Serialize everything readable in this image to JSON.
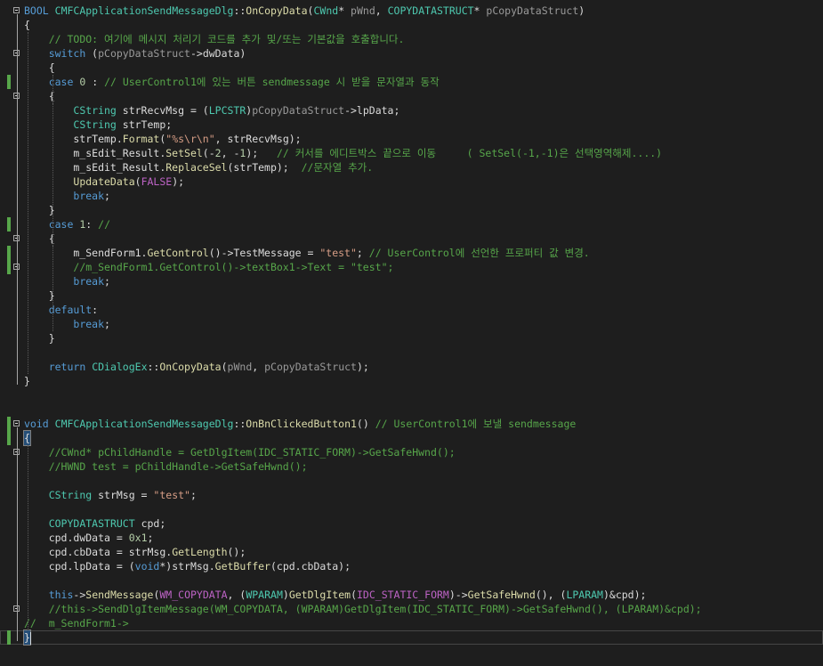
{
  "colors": {
    "text": "#dcdcdc",
    "keyword": "#569cd6",
    "type": "#4ec9b0",
    "function": "#dcdcaa",
    "string": "#d69d85",
    "comment": "#57a64a",
    "macro": "#bd63c5",
    "param": "#9a9a9a",
    "number": "#b5cea8",
    "member": "#dadada",
    "change_marker": "#57a64a"
  },
  "icons": {
    "fold": "collapse-minus-icon",
    "change": "change-marker-icon"
  },
  "editor": {
    "lines": [
      {
        "fold": true,
        "mark": false,
        "tokens": [
          [
            "kw",
            "BOOL"
          ],
          [
            "t",
            " "
          ],
          [
            "ty",
            "CMFCApplicationSendMessageDlg"
          ],
          [
            "t",
            "::"
          ],
          [
            "fn",
            "OnCopyData"
          ],
          [
            "t",
            "("
          ],
          [
            "ty",
            "CWnd"
          ],
          [
            "t",
            "* "
          ],
          [
            "pa",
            "pWnd"
          ],
          [
            "t",
            ", "
          ],
          [
            "ty",
            "COPYDATASTRUCT"
          ],
          [
            "t",
            "* "
          ],
          [
            "pa",
            "pCopyDataStruct"
          ],
          [
            "t",
            ")"
          ]
        ]
      },
      {
        "fold": false,
        "mark": false,
        "tokens": [
          [
            "t",
            "{"
          ]
        ]
      },
      {
        "fold": false,
        "mark": false,
        "tokens": [
          [
            "t",
            "    "
          ],
          [
            "cm",
            "// TODO: 여기에 메시지 처리기 코드를 추가 및/또는 기본값을 호출합니다."
          ]
        ]
      },
      {
        "fold": true,
        "mark": false,
        "tokens": [
          [
            "t",
            "    "
          ],
          [
            "kw",
            "switch"
          ],
          [
            "t",
            " ("
          ],
          [
            "pa",
            "pCopyDataStruct"
          ],
          [
            "t",
            "->"
          ],
          [
            "mb",
            "dwData"
          ],
          [
            "t",
            ")"
          ]
        ]
      },
      {
        "fold": false,
        "mark": false,
        "tokens": [
          [
            "t",
            "    {"
          ]
        ]
      },
      {
        "fold": false,
        "mark": true,
        "tokens": [
          [
            "t",
            "    "
          ],
          [
            "kw",
            "case"
          ],
          [
            "t",
            " "
          ],
          [
            "nm",
            "0"
          ],
          [
            "t",
            " : "
          ],
          [
            "cm",
            "// UserControl1에 있는 버튼 sendmessage 시 받을 문자열과 동작"
          ]
        ]
      },
      {
        "fold": true,
        "mark": false,
        "tokens": [
          [
            "t",
            "    {"
          ]
        ]
      },
      {
        "fold": false,
        "mark": false,
        "tokens": [
          [
            "t",
            "        "
          ],
          [
            "ty",
            "CString"
          ],
          [
            "t",
            " strRecvMsg = ("
          ],
          [
            "ty",
            "LPCSTR"
          ],
          [
            "t",
            ")"
          ],
          [
            "pa",
            "pCopyDataStruct"
          ],
          [
            "t",
            "->"
          ],
          [
            "mb",
            "lpData"
          ],
          [
            "t",
            ";"
          ]
        ]
      },
      {
        "fold": false,
        "mark": false,
        "tokens": [
          [
            "t",
            "        "
          ],
          [
            "ty",
            "CString"
          ],
          [
            "t",
            " strTemp;"
          ]
        ]
      },
      {
        "fold": false,
        "mark": false,
        "tokens": [
          [
            "t",
            "        strTemp."
          ],
          [
            "fn",
            "Format"
          ],
          [
            "t",
            "("
          ],
          [
            "st",
            "\"%s\\r\\n\""
          ],
          [
            "t",
            ", strRecvMsg);"
          ]
        ]
      },
      {
        "fold": false,
        "mark": false,
        "tokens": [
          [
            "t",
            "        m_sEdit_Result."
          ],
          [
            "fn",
            "SetSel"
          ],
          [
            "t",
            "(-"
          ],
          [
            "nm",
            "2"
          ],
          [
            "t",
            ", -"
          ],
          [
            "nm",
            "1"
          ],
          [
            "t",
            ");   "
          ],
          [
            "cm",
            "// 커서를 에디트박스 끝으로 이동     ( SetSel(-1,-1)은 선택영역해제....)"
          ]
        ]
      },
      {
        "fold": false,
        "mark": false,
        "tokens": [
          [
            "t",
            "        m_sEdit_Result."
          ],
          [
            "fn",
            "ReplaceSel"
          ],
          [
            "t",
            "(strTemp);  "
          ],
          [
            "cm",
            "//문자열 추가."
          ]
        ]
      },
      {
        "fold": false,
        "mark": false,
        "tokens": [
          [
            "t",
            "        "
          ],
          [
            "fn",
            "UpdateData"
          ],
          [
            "t",
            "("
          ],
          [
            "mc",
            "FALSE"
          ],
          [
            "t",
            ");"
          ]
        ]
      },
      {
        "fold": false,
        "mark": false,
        "tokens": [
          [
            "t",
            "        "
          ],
          [
            "kw",
            "break"
          ],
          [
            "t",
            ";"
          ]
        ]
      },
      {
        "fold": false,
        "mark": false,
        "tokens": [
          [
            "t",
            "    }"
          ]
        ]
      },
      {
        "fold": false,
        "mark": true,
        "tokens": [
          [
            "t",
            "    "
          ],
          [
            "kw",
            "case"
          ],
          [
            "t",
            " "
          ],
          [
            "nm",
            "1"
          ],
          [
            "t",
            ": "
          ],
          [
            "cm",
            "//"
          ]
        ]
      },
      {
        "fold": true,
        "mark": false,
        "tokens": [
          [
            "t",
            "    {"
          ]
        ]
      },
      {
        "fold": false,
        "mark": true,
        "tokens": [
          [
            "t",
            "        m_SendForm1."
          ],
          [
            "fn",
            "GetControl"
          ],
          [
            "t",
            "()->TestMessage = "
          ],
          [
            "st",
            "\"test\""
          ],
          [
            "t",
            "; "
          ],
          [
            "cm",
            "// UserControl에 선언한 프로퍼티 값 변경."
          ]
        ]
      },
      {
        "fold": true,
        "mark": true,
        "tokens": [
          [
            "t",
            "        "
          ],
          [
            "cm",
            "//m_SendForm1.GetControl()->textBox1->Text = \"test\";"
          ]
        ]
      },
      {
        "fold": false,
        "mark": false,
        "tokens": [
          [
            "t",
            "        "
          ],
          [
            "kw",
            "break"
          ],
          [
            "t",
            ";"
          ]
        ]
      },
      {
        "fold": false,
        "mark": false,
        "tokens": [
          [
            "t",
            "    }"
          ]
        ]
      },
      {
        "fold": false,
        "mark": false,
        "tokens": [
          [
            "t",
            "    "
          ],
          [
            "kw",
            "default"
          ],
          [
            "t",
            ":"
          ]
        ]
      },
      {
        "fold": false,
        "mark": false,
        "tokens": [
          [
            "t",
            "        "
          ],
          [
            "kw",
            "break"
          ],
          [
            "t",
            ";"
          ]
        ]
      },
      {
        "fold": false,
        "mark": false,
        "tokens": [
          [
            "t",
            "    }"
          ]
        ]
      },
      {
        "fold": false,
        "mark": false,
        "tokens": [
          [
            "t",
            ""
          ]
        ]
      },
      {
        "fold": false,
        "mark": false,
        "tokens": [
          [
            "t",
            "    "
          ],
          [
            "kw",
            "return"
          ],
          [
            "t",
            " "
          ],
          [
            "ty",
            "CDialogEx"
          ],
          [
            "t",
            "::"
          ],
          [
            "fn",
            "OnCopyData"
          ],
          [
            "t",
            "("
          ],
          [
            "pa",
            "pWnd"
          ],
          [
            "t",
            ", "
          ],
          [
            "pa",
            "pCopyDataStruct"
          ],
          [
            "t",
            ");"
          ]
        ]
      },
      {
        "fold": false,
        "mark": false,
        "tokens": [
          [
            "t",
            "}"
          ]
        ]
      },
      {
        "fold": false,
        "mark": false,
        "tokens": [
          [
            "t",
            ""
          ]
        ]
      },
      {
        "fold": false,
        "mark": false,
        "tokens": [
          [
            "t",
            ""
          ]
        ]
      },
      {
        "fold": true,
        "mark": true,
        "tokens": [
          [
            "kw",
            "void"
          ],
          [
            "t",
            " "
          ],
          [
            "ty",
            "CMFCApplicationSendMessageDlg"
          ],
          [
            "t",
            "::"
          ],
          [
            "fn",
            "OnBnClickedButton1"
          ],
          [
            "t",
            "() "
          ],
          [
            "cm",
            "// UserControl1에 보낼 sendmessage"
          ]
        ]
      },
      {
        "fold": false,
        "mark": true,
        "tokens": [
          [
            "box",
            "{"
          ]
        ]
      },
      {
        "fold": true,
        "mark": false,
        "tokens": [
          [
            "t",
            "    "
          ],
          [
            "cm",
            "//CWnd* pChildHandle = GetDlgItem(IDC_STATIC_FORM)->GetSafeHwnd();"
          ]
        ]
      },
      {
        "fold": false,
        "mark": false,
        "tokens": [
          [
            "t",
            "    "
          ],
          [
            "cm",
            "//HWND test = pChildHandle->GetSafeHwnd();"
          ]
        ]
      },
      {
        "fold": false,
        "mark": false,
        "tokens": [
          [
            "t",
            ""
          ]
        ]
      },
      {
        "fold": false,
        "mark": false,
        "tokens": [
          [
            "t",
            "    "
          ],
          [
            "ty",
            "CString"
          ],
          [
            "t",
            " strMsg = "
          ],
          [
            "st",
            "\"test\""
          ],
          [
            "t",
            ";"
          ]
        ]
      },
      {
        "fold": false,
        "mark": false,
        "tokens": [
          [
            "t",
            ""
          ]
        ]
      },
      {
        "fold": false,
        "mark": false,
        "tokens": [
          [
            "t",
            "    "
          ],
          [
            "ty",
            "COPYDATASTRUCT"
          ],
          [
            "t",
            " cpd;"
          ]
        ]
      },
      {
        "fold": false,
        "mark": false,
        "tokens": [
          [
            "t",
            "    cpd."
          ],
          [
            "mb",
            "dwData"
          ],
          [
            "t",
            " = "
          ],
          [
            "nm",
            "0x1"
          ],
          [
            "t",
            ";"
          ]
        ]
      },
      {
        "fold": false,
        "mark": false,
        "tokens": [
          [
            "t",
            "    cpd."
          ],
          [
            "mb",
            "cbData"
          ],
          [
            "t",
            " = strMsg."
          ],
          [
            "fn",
            "GetLength"
          ],
          [
            "t",
            "();"
          ]
        ]
      },
      {
        "fold": false,
        "mark": false,
        "tokens": [
          [
            "t",
            "    cpd."
          ],
          [
            "mb",
            "lpData"
          ],
          [
            "t",
            " = ("
          ],
          [
            "kw",
            "void"
          ],
          [
            "t",
            "*)strMsg."
          ],
          [
            "fn",
            "GetBuffer"
          ],
          [
            "t",
            "(cpd."
          ],
          [
            "mb",
            "cbData"
          ],
          [
            "t",
            ");"
          ]
        ]
      },
      {
        "fold": false,
        "mark": false,
        "tokens": [
          [
            "t",
            ""
          ]
        ]
      },
      {
        "fold": false,
        "mark": false,
        "tokens": [
          [
            "t",
            "    "
          ],
          [
            "kw",
            "this"
          ],
          [
            "t",
            "->"
          ],
          [
            "fn",
            "SendMessage"
          ],
          [
            "t",
            "("
          ],
          [
            "mc",
            "WM_COPYDATA"
          ],
          [
            "t",
            ", ("
          ],
          [
            "ty",
            "WPARAM"
          ],
          [
            "t",
            ")"
          ],
          [
            "fn",
            "GetDlgItem"
          ],
          [
            "t",
            "("
          ],
          [
            "mc",
            "IDC_STATIC_FORM"
          ],
          [
            "t",
            ")->"
          ],
          [
            "fn",
            "GetSafeHwnd"
          ],
          [
            "t",
            "(), ("
          ],
          [
            "ty",
            "LPARAM"
          ],
          [
            "t",
            ")&cpd);"
          ]
        ]
      },
      {
        "fold": true,
        "mark": false,
        "tokens": [
          [
            "t",
            "    "
          ],
          [
            "cm",
            "//this->SendDlgItemMessage(WM_COPYDATA, (WPARAM)GetDlgItem(IDC_STATIC_FORM)->GetSafeHwnd(), (LPARAM)&cpd);"
          ]
        ]
      },
      {
        "fold": false,
        "mark": false,
        "tokens": [
          [
            "cm",
            "//  m_SendForm1->"
          ]
        ]
      },
      {
        "fold": false,
        "mark": true,
        "caret": true,
        "tokens": [
          [
            "box",
            "}"
          ]
        ]
      }
    ]
  }
}
